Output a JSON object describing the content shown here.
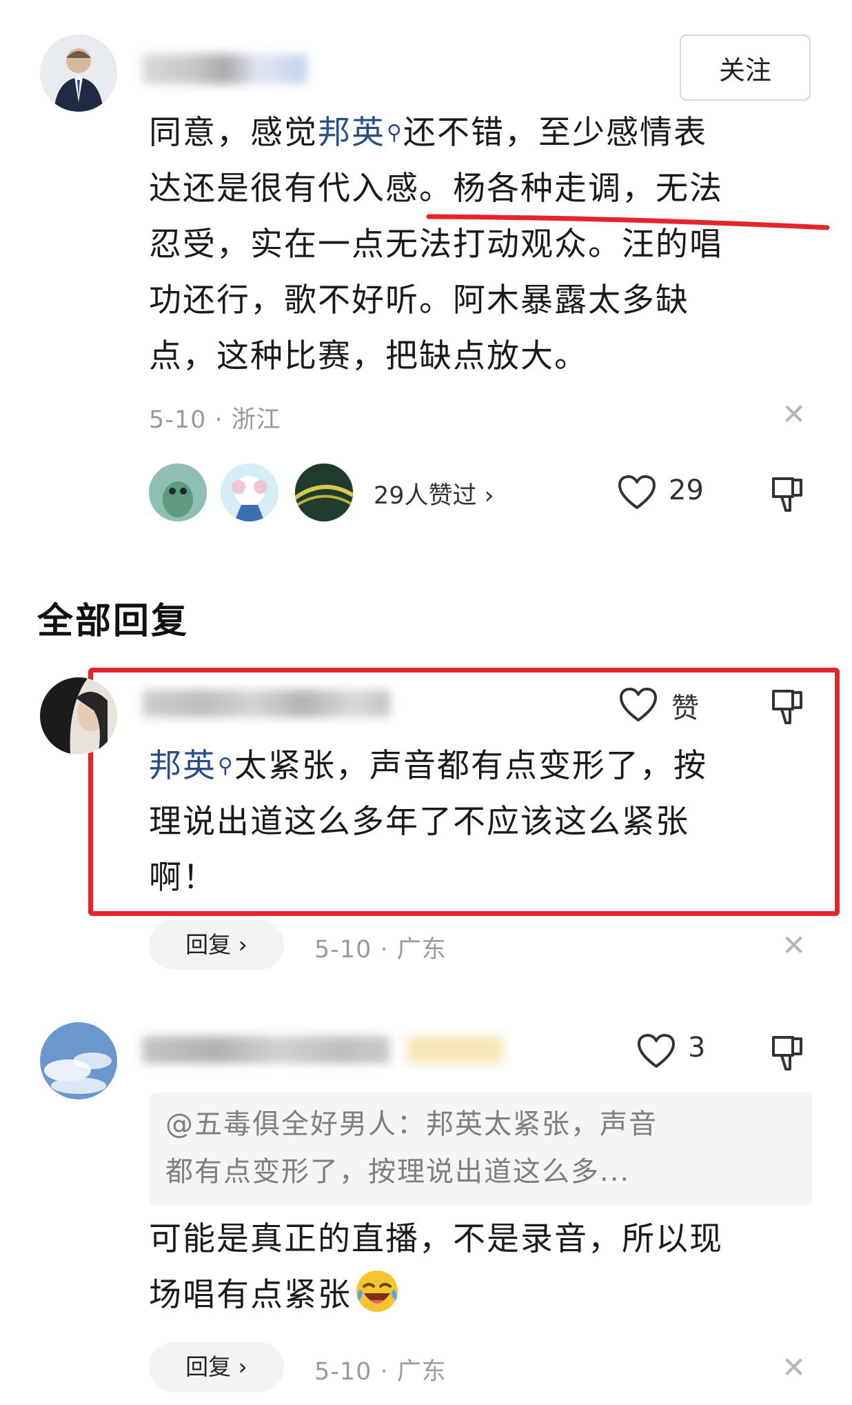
{
  "top_comment": {
    "follow_label": "关注",
    "text_parts": {
      "before": "同意，感觉",
      "mention": "邦英",
      "line_a": "还不错，至少感情表",
      "line_b": "达还是很有代入感。杨各种走调，无法",
      "line_c": "忍受，实在一点无法打动观众。汪的唱",
      "line_d": "功还行，歌不好听。阿木暴露太多缺",
      "line_e": "点，这种比赛，把缺点放大。"
    },
    "meta": "5-10 · 浙江",
    "likes_summary": "29人赞过 ›",
    "like_count": "29"
  },
  "section_title": "全部回复",
  "reply1": {
    "like_label": "赞",
    "mention": "邦英",
    "line_a": "太紧张，声音都有点变形了，按",
    "line_b": "理说出道这么多年了不应该这么紧张",
    "line_c": "啊！",
    "reply_label": "回复 ›",
    "meta": "5-10 · 广东"
  },
  "reply2": {
    "like_count": "3",
    "quote_line_a": "@五毒俱全好男人：邦英太紧张，声音",
    "quote_line_b": "都有点变形了，按理说出道这么多...",
    "line_a": "可能是真正的直播，不是录音，所以现",
    "line_b": "场唱有点紧张",
    "reply_label": "回复 ›",
    "meta": "5-10 · 广东"
  },
  "colors": {
    "mention": "#2b4d8c",
    "highlight_red": "#e5252c",
    "meta_gray": "#9a9a9a"
  }
}
